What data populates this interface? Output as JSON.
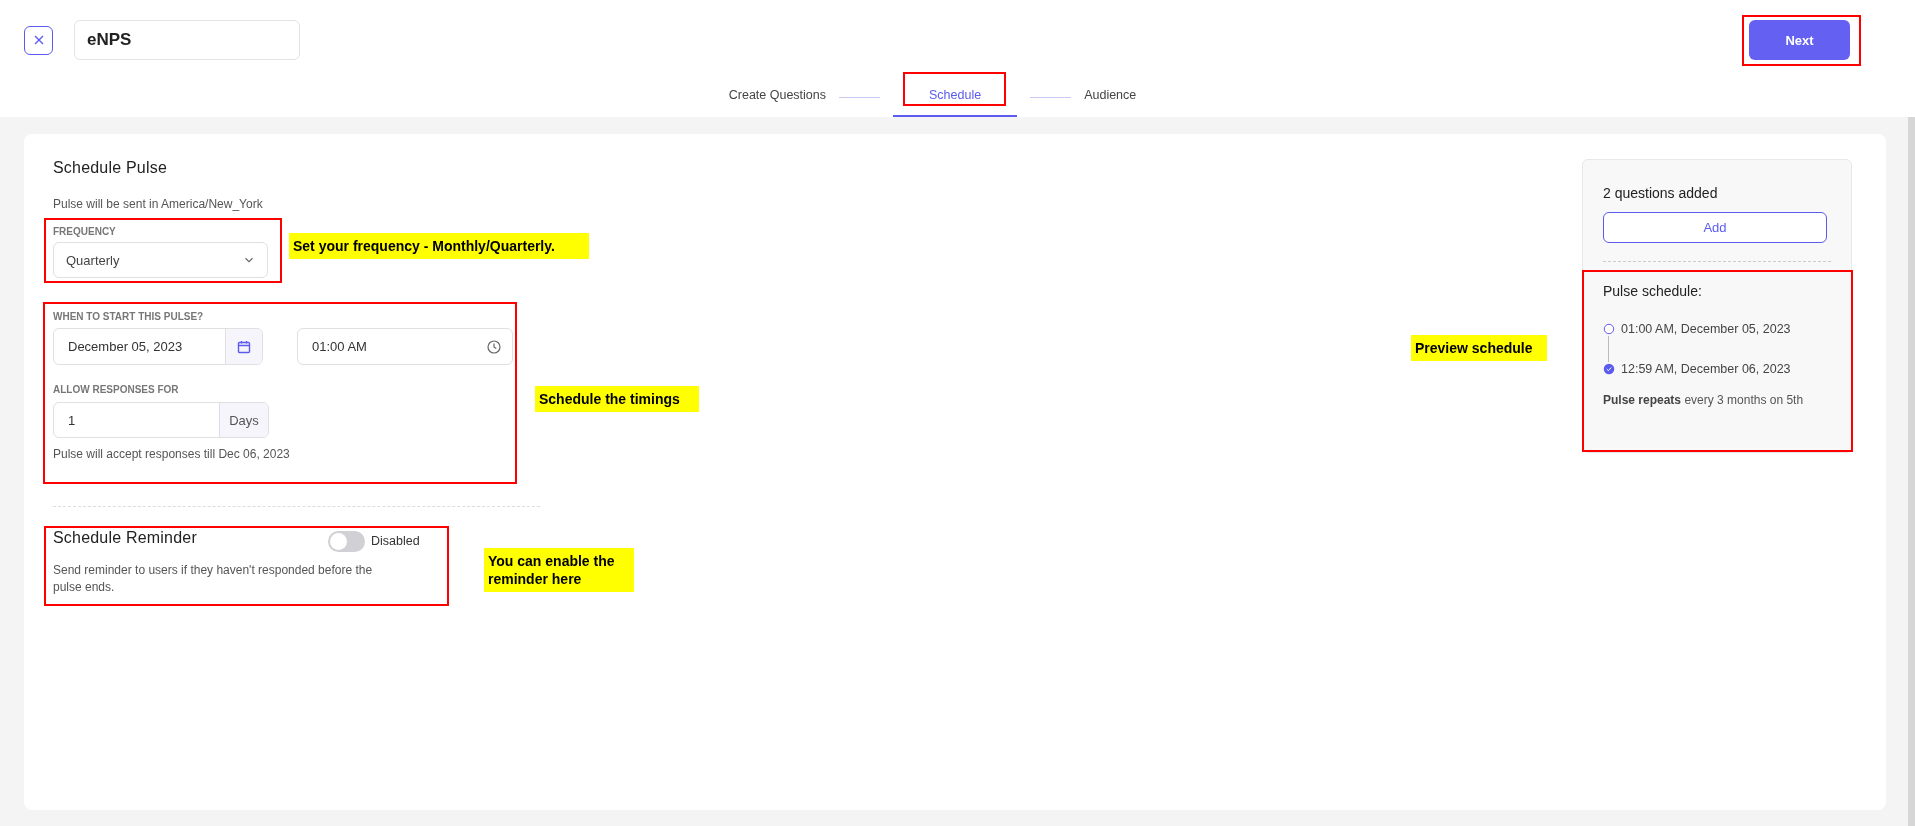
{
  "header": {
    "title_field": {
      "value": "eNPS"
    },
    "next_button": "Next"
  },
  "steps": [
    {
      "label": "Create Questions",
      "selected": false
    },
    {
      "label": "Schedule",
      "selected": true
    },
    {
      "label": "Audience",
      "selected": false
    }
  ],
  "schedule_pulse": {
    "title": "Schedule Pulse",
    "timezone_note": "Pulse will be sent in America/New_York",
    "frequency": {
      "label": "FREQUENCY",
      "value": "Quarterly"
    },
    "start": {
      "label": "WHEN TO START THIS PULSE?",
      "date": "December 05, 2023",
      "time": "01:00 AM"
    },
    "responses": {
      "label": "ALLOW RESPONSES FOR",
      "value": "1",
      "unit": "Days",
      "note": "Pulse will accept responses till Dec 06, 2023"
    }
  },
  "reminder": {
    "title": "Schedule Reminder",
    "on": false,
    "toggle_label": "Disabled",
    "description": "Send reminder to users if they haven't responded before the pulse ends."
  },
  "summary": {
    "questions_count": "2 questions added",
    "add_button": "Add",
    "schedule_title": "Pulse schedule:",
    "timeline": [
      {
        "text": "01:00 AM, December 05, 2023",
        "done": false
      },
      {
        "text": "12:59 AM, December 06, 2023",
        "done": true
      }
    ],
    "repeat_note": "**Pulse repeats** every 3 months on 5th"
  },
  "annotations": [
    {
      "text": "Set your frequency - Monthly/Quarterly."
    },
    {
      "text": "Schedule the timings"
    },
    {
      "text": "You can enable the reminder here"
    },
    {
      "text": "Preview schedule"
    }
  ]
}
